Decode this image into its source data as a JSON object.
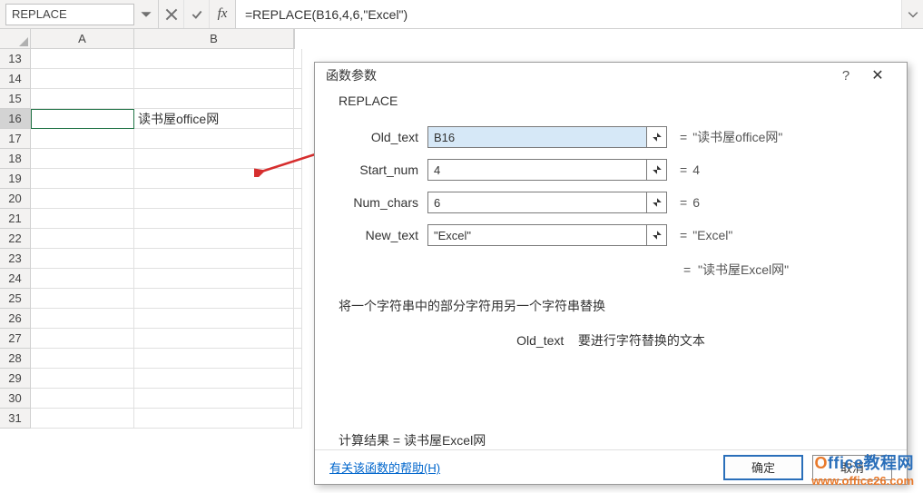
{
  "namebox": "REPLACE",
  "formula": "=REPLACE(B16,4,6,\"Excel\")",
  "columns": [
    "A",
    "B"
  ],
  "rows": [
    13,
    14,
    15,
    16,
    17,
    18,
    19,
    20,
    21,
    22,
    23,
    24,
    25,
    26,
    27,
    28,
    29,
    30,
    31
  ],
  "activeRow": 16,
  "b16_value": "读书屋office网",
  "dialog": {
    "title": "函数参数",
    "fn_name": "REPLACE",
    "params": [
      {
        "label": "Old_text",
        "value": "B16",
        "result": "\"读书屋office网\"",
        "highlight": true
      },
      {
        "label": "Start_num",
        "value": "4",
        "result": "4",
        "highlight": false
      },
      {
        "label": "Num_chars",
        "value": "6",
        "result": "6",
        "highlight": false
      },
      {
        "label": "New_text",
        "value": "\"Excel\"",
        "result": "\"Excel\"",
        "highlight": false
      }
    ],
    "return_value": "\"读书屋Excel网\"",
    "description": "将一个字符串中的部分字符用另一个字符串替换",
    "param_desc_label": "Old_text",
    "param_desc_text": "要进行字符替换的文本",
    "calc_label": "计算结果 = ",
    "calc_value": "读书屋Excel网",
    "help_link": "有关该函数的帮助(H)",
    "ok": "确定",
    "cancel": "取消"
  },
  "watermark": {
    "line1a": "O",
    "line1b": "ffice教程网",
    "line2": "www.office26.com"
  }
}
